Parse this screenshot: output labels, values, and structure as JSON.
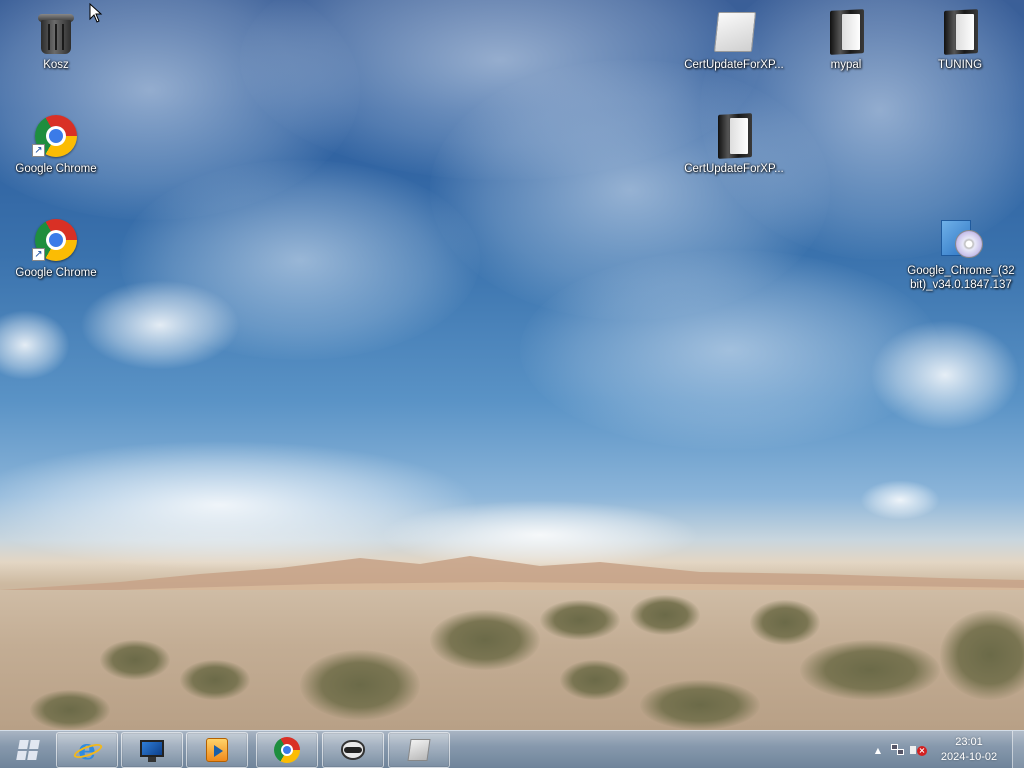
{
  "desktop": {
    "icons": [
      {
        "label": "Kosz",
        "icon": "recycle-bin-icon"
      },
      {
        "label": "Google Chrome",
        "icon": "chrome-icon"
      },
      {
        "label": "Google Chrome",
        "icon": "chrome-icon"
      },
      {
        "label": "CertUpdateForXP...",
        "icon": "file-icon"
      },
      {
        "label": "mypal",
        "icon": "folder-icon"
      },
      {
        "label": "TUNING",
        "icon": "folder-icon"
      },
      {
        "label": "CertUpdateForXP...",
        "icon": "folder-icon"
      },
      {
        "label": "Google_Chrome_(32bit)_v34.0.1847.137",
        "icon": "installer-icon"
      }
    ]
  },
  "taskbar": {
    "start": {
      "icon": "windows-orb-icon"
    },
    "pinned": [
      {
        "name": "internet-explorer",
        "icon": "internet-explorer-icon"
      },
      {
        "name": "computer",
        "icon": "monitor-icon"
      },
      {
        "name": "media-player",
        "icon": "media-player-icon"
      },
      {
        "name": "google-chrome",
        "icon": "chrome-icon"
      },
      {
        "name": "raccoon-app",
        "icon": "raccoon-icon"
      },
      {
        "name": "document",
        "icon": "document-icon"
      }
    ],
    "tray": {
      "overflow_glyph": "▲",
      "time": "23:01",
      "date": "2024-10-02"
    }
  },
  "colors": {
    "taskbar_top": "#a9b5c3",
    "taskbar_bottom": "#6f849a",
    "label_text": "#ffffff"
  }
}
